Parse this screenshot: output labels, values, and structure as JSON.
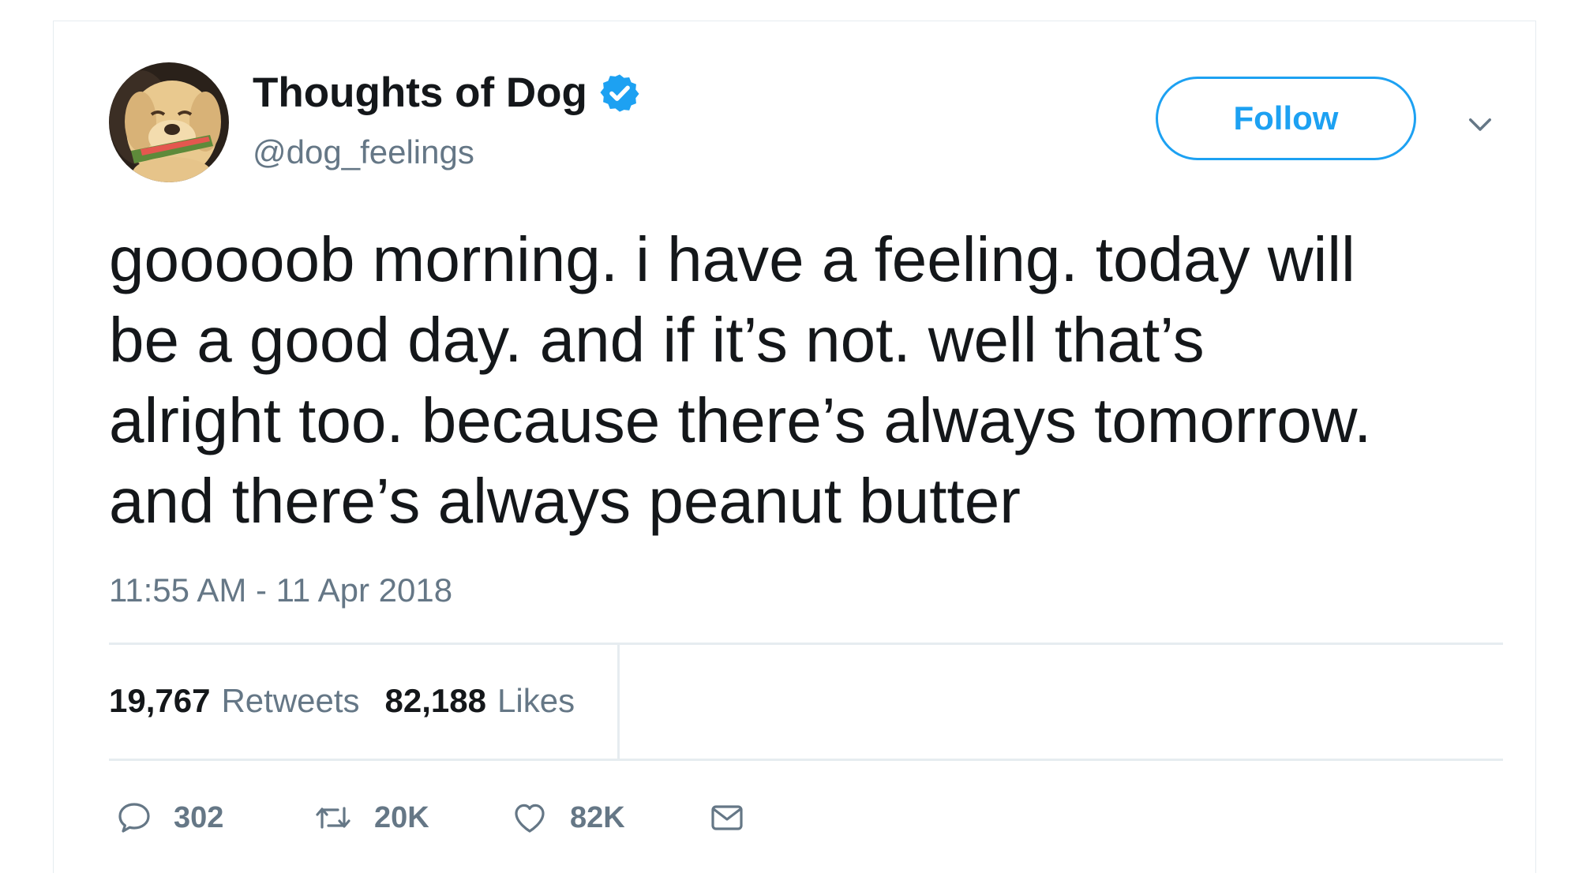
{
  "tweet": {
    "author": {
      "display_name": "Thoughts of Dog",
      "handle": "@dog_feelings",
      "verified": true
    },
    "follow_label": "Follow",
    "text": "gooooob morning. i have a feeling. today will\nbe a good day. and if it’s not. well that’s\nalright too. because there’s always tomorrow.\nand there’s always peanut butter",
    "timestamp": "11:55 AM - 11 Apr 2018",
    "stats": {
      "retweets_count": "19,767",
      "retweets_label": "Retweets",
      "likes_count": "82,188",
      "likes_label": "Likes"
    },
    "actions": {
      "reply_count": "302",
      "retweet_count": "20K",
      "like_count": "82K"
    }
  },
  "colors": {
    "accent": "#1da1f2",
    "text_primary": "#14171a",
    "text_secondary": "#657786",
    "divider": "#e6ecf0"
  },
  "icons": {
    "verified": "verified-badge-icon",
    "caret": "chevron-down-icon",
    "reply": "reply-bubble-icon",
    "retweet": "retweet-icon",
    "like": "heart-icon",
    "dm": "envelope-icon"
  }
}
